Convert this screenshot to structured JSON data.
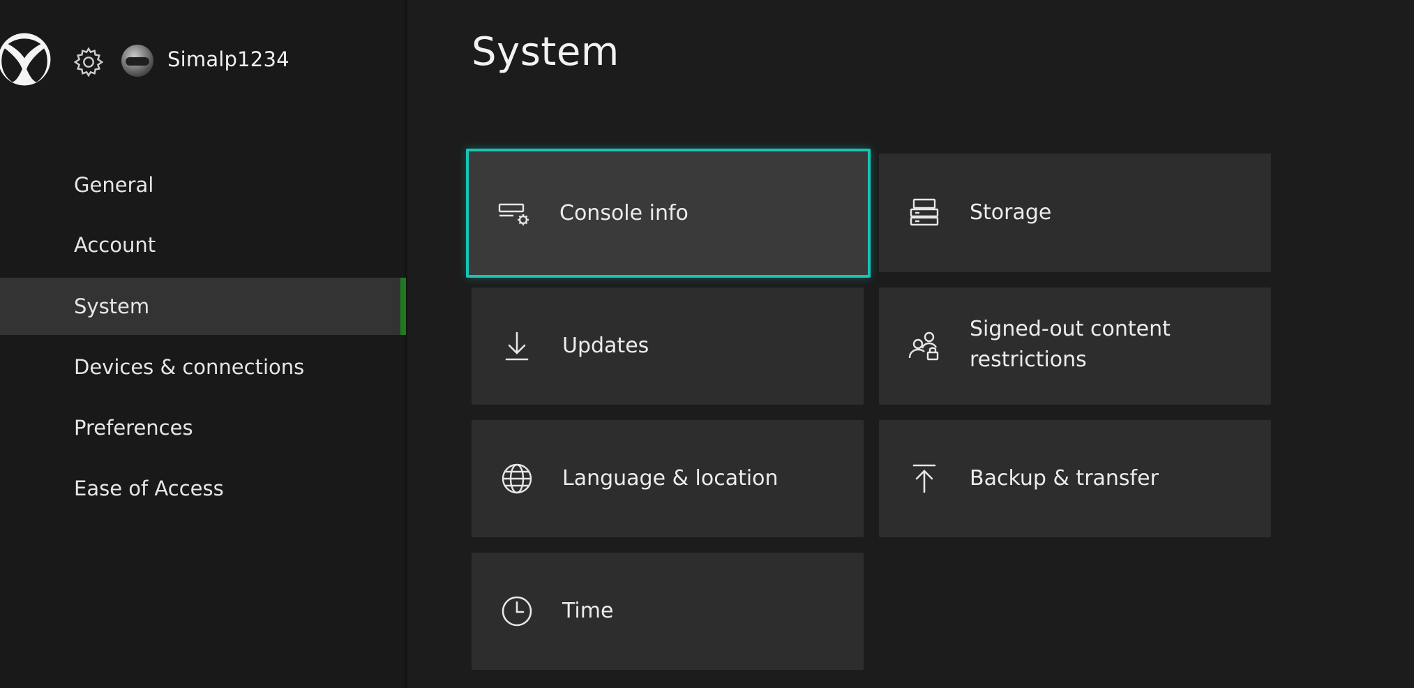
{
  "profile": {
    "username": "Simalp1234"
  },
  "nav": {
    "items": [
      {
        "label": "General",
        "selected": false
      },
      {
        "label": "Account",
        "selected": false
      },
      {
        "label": "System",
        "selected": true
      },
      {
        "label": "Devices & connections",
        "selected": false
      },
      {
        "label": "Preferences",
        "selected": false
      },
      {
        "label": "Ease of Access",
        "selected": false
      }
    ]
  },
  "page": {
    "title": "System"
  },
  "tiles": [
    {
      "label": "Console info",
      "icon": "console-info-icon",
      "focused": true
    },
    {
      "label": "Storage",
      "icon": "storage-icon",
      "focused": false
    },
    {
      "label": "Updates",
      "icon": "download-icon",
      "focused": false
    },
    {
      "label_line1": "Signed-out content",
      "label_line2": "restrictions",
      "icon": "people-lock-icon",
      "focused": false
    },
    {
      "label": "Language & location",
      "icon": "globe-icon",
      "focused": false
    },
    {
      "label": "Backup & transfer",
      "icon": "upload-icon",
      "focused": false
    },
    {
      "label": "Time",
      "icon": "clock-icon",
      "focused": false
    }
  ],
  "colors": {
    "focus_outline": "#19c3b6",
    "selected_indicator": "#1f7a1f",
    "tile_bg": "#2d2d2d",
    "sidebar_selected_bg": "#333333"
  }
}
